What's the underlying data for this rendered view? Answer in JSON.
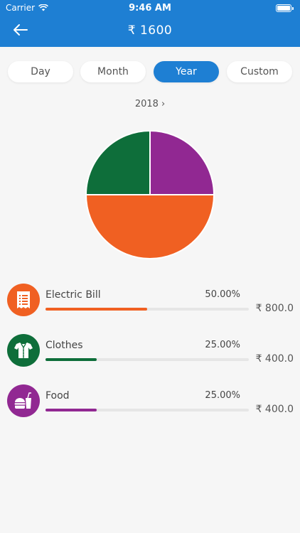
{
  "status_bar": {
    "carrier": "Carrier",
    "time": "9:46 AM"
  },
  "header": {
    "title": "₹ 1600",
    "back_icon": "arrow-left-icon"
  },
  "segments": [
    {
      "label": "Day",
      "active": false
    },
    {
      "label": "Month",
      "active": false
    },
    {
      "label": "Year",
      "active": true
    },
    {
      "label": "Custom",
      "active": false
    }
  ],
  "period": {
    "label": "2018",
    "chevron": "›"
  },
  "colors": {
    "header": "#1e7fd3",
    "electric": "#f06022",
    "clothes": "#0e6e3a",
    "food": "#912892"
  },
  "chart_data": {
    "type": "pie",
    "slices": [
      {
        "label": "Electric Bill",
        "value": 50.0,
        "color": "#f06022"
      },
      {
        "label": "Clothes",
        "value": 25.0,
        "color": "#0e6e3a"
      },
      {
        "label": "Food",
        "value": 25.0,
        "color": "#912892"
      }
    ]
  },
  "categories": [
    {
      "name": "Electric Bill",
      "percent": "50.00%",
      "amount": "₹ 800.0",
      "fraction": 0.5,
      "icon": "receipt-icon",
      "color": "#f06022"
    },
    {
      "name": "Clothes",
      "percent": "25.00%",
      "amount": "₹ 400.0",
      "fraction": 0.25,
      "icon": "shirt-icon",
      "color": "#0e6e3a"
    },
    {
      "name": "Food",
      "percent": "25.00%",
      "amount": "₹ 400.0",
      "fraction": 0.25,
      "icon": "fastfood-icon",
      "color": "#912892"
    }
  ]
}
